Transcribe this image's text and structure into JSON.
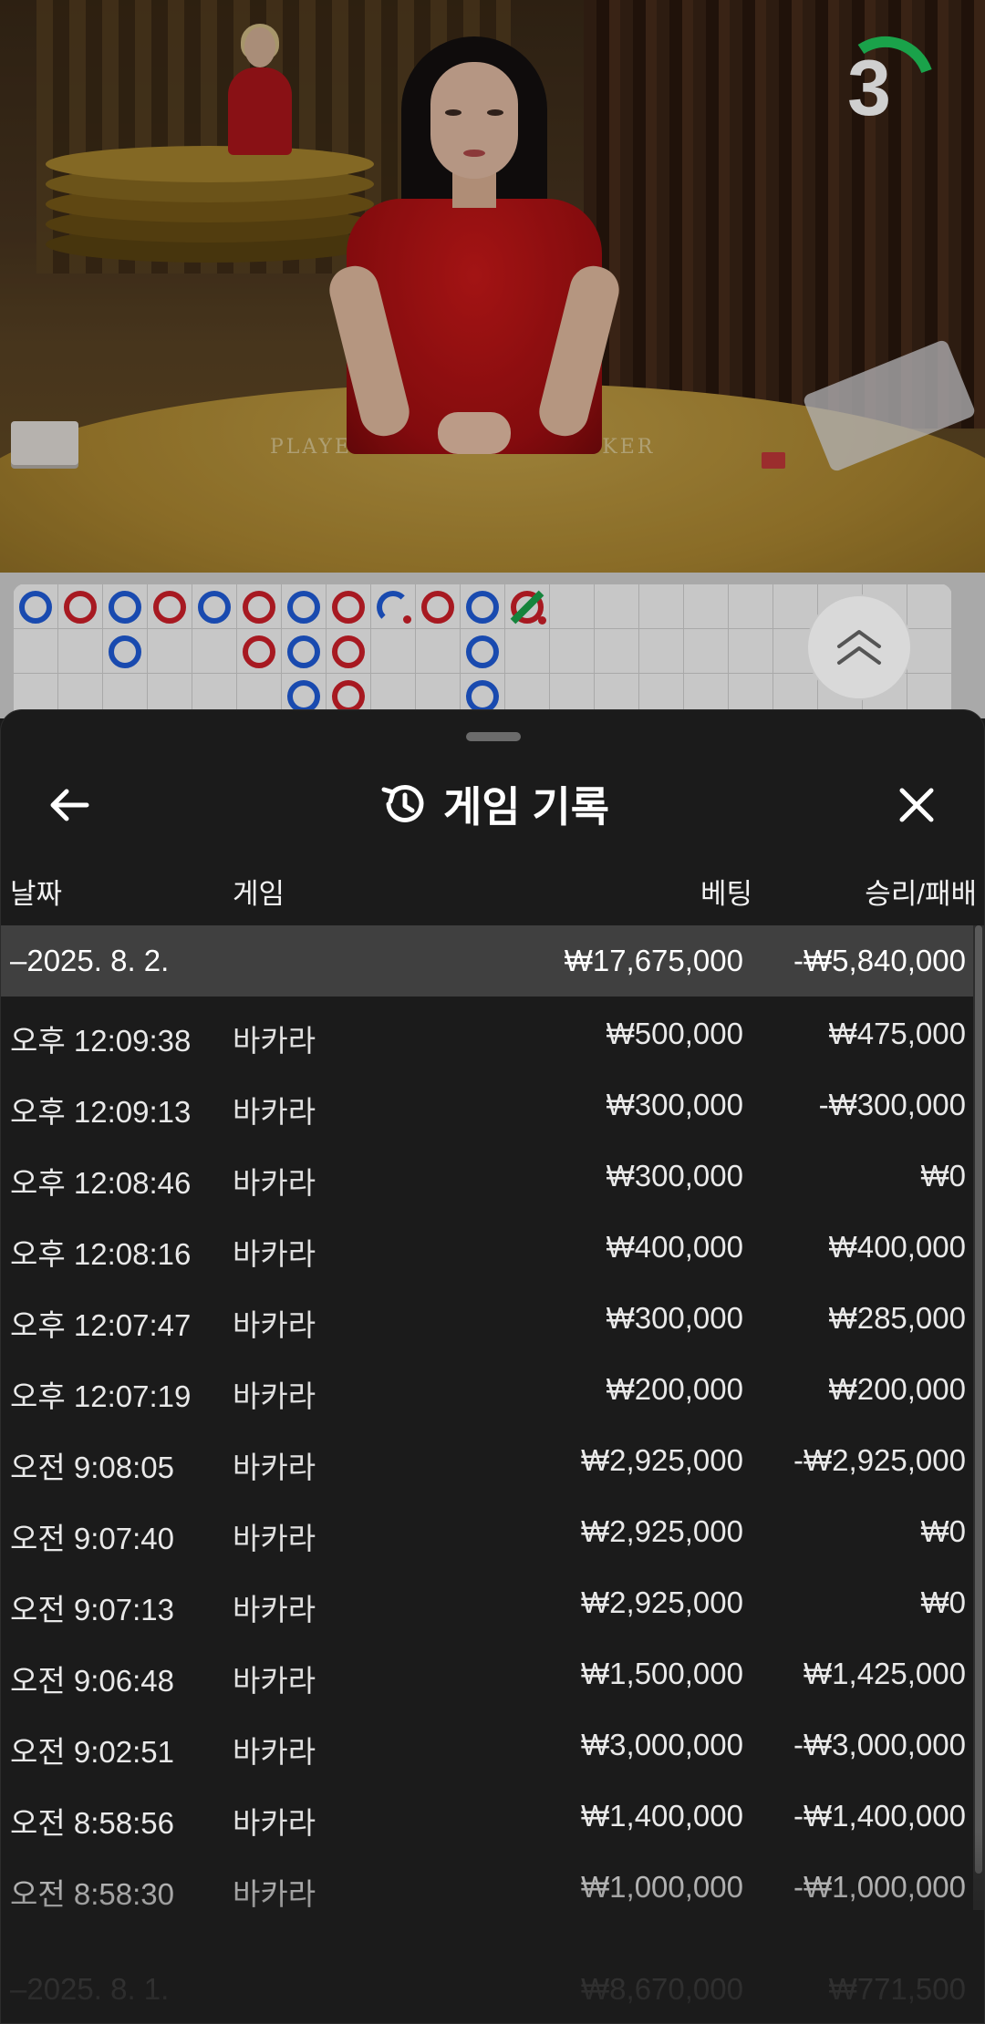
{
  "video": {
    "countdown": "3",
    "countdown_color": "#1aa24a",
    "table_labels": [
      "PLAYER",
      "BANKER"
    ]
  },
  "roadmap": {
    "scroll_button_icon": "double-chevron-up-icon",
    "colors": {
      "banker": "#cc1f29",
      "player": "#1f5bd6",
      "tie": "#1aa24a"
    }
  },
  "history": {
    "title": "게임 기록",
    "title_icon": "history-clock-icon",
    "back_icon": "arrow-left-icon",
    "close_icon": "close-icon",
    "columns": {
      "date": "날짜",
      "game": "게임",
      "bet": "베팅",
      "result": "승리/패배"
    },
    "day": {
      "label": "–2025. 8. 2.",
      "bet": "₩17,675,000",
      "result": "-₩5,840,000"
    },
    "rows": [
      {
        "time": "오후 12:09:38",
        "game": "바카라",
        "bet": "₩500,000",
        "result": "₩475,000"
      },
      {
        "time": "오후 12:09:13",
        "game": "바카라",
        "bet": "₩300,000",
        "result": "-₩300,000"
      },
      {
        "time": "오후 12:08:46",
        "game": "바카라",
        "bet": "₩300,000",
        "result": "₩0"
      },
      {
        "time": "오후 12:08:16",
        "game": "바카라",
        "bet": "₩400,000",
        "result": "₩400,000"
      },
      {
        "time": "오후 12:07:47",
        "game": "바카라",
        "bet": "₩300,000",
        "result": "₩285,000"
      },
      {
        "time": "오후 12:07:19",
        "game": "바카라",
        "bet": "₩200,000",
        "result": "₩200,000"
      },
      {
        "time": "오전 9:08:05",
        "game": "바카라",
        "bet": "₩2,925,000",
        "result": "-₩2,925,000"
      },
      {
        "time": "오전 9:07:40",
        "game": "바카라",
        "bet": "₩2,925,000",
        "result": "₩0"
      },
      {
        "time": "오전 9:07:13",
        "game": "바카라",
        "bet": "₩2,925,000",
        "result": "₩0"
      },
      {
        "time": "오전 9:06:48",
        "game": "바카라",
        "bet": "₩1,500,000",
        "result": "₩1,425,000"
      },
      {
        "time": "오전 9:02:51",
        "game": "바카라",
        "bet": "₩3,000,000",
        "result": "-₩3,000,000"
      },
      {
        "time": "오전 8:58:56",
        "game": "바카라",
        "bet": "₩1,400,000",
        "result": "-₩1,400,000"
      },
      {
        "time": "오전 8:58:30",
        "game": "바카라",
        "bet": "₩1,000,000",
        "result": "-₩1,000,000"
      }
    ],
    "next_day": {
      "label": "–2025. 8. 1.",
      "bet": "₩8,670,000",
      "result": "₩771,500"
    }
  }
}
